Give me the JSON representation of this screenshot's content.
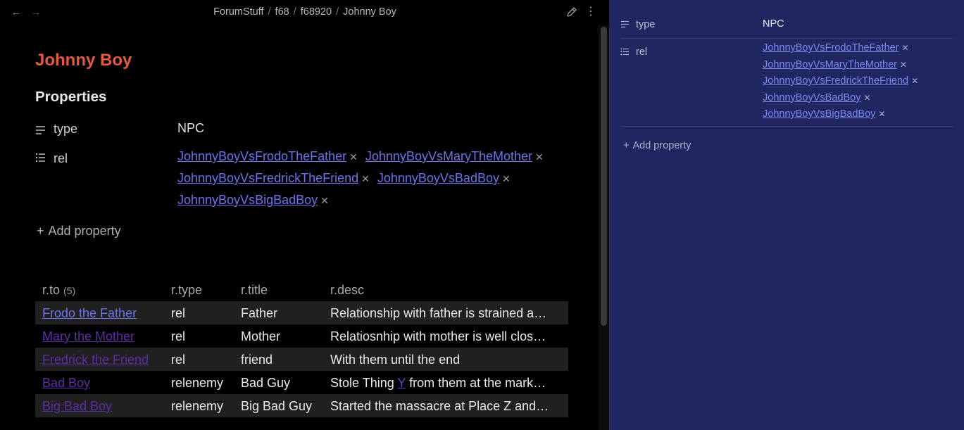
{
  "breadcrumb": [
    "ForumStuff",
    "f68",
    "f68920",
    "Johnny Boy"
  ],
  "breadcrumb_sep": "/",
  "icons": {
    "back": "arrow-left-icon",
    "forward": "arrow-right-icon",
    "edit": "pencil-icon",
    "more": "more-vertical-icon",
    "text_prop": "lines-icon",
    "list_prop": "list-icon",
    "remove": "close-icon",
    "add": "plus-icon"
  },
  "note": {
    "title": "Johnny Boy",
    "properties_heading": "Properties",
    "props": {
      "type_key": "type",
      "type_value": "NPC",
      "rel_key": "rel",
      "rel_links": [
        "JohnnyBoyVsFrodoTheFather",
        "JohnnyBoyVsMaryTheMother",
        "JohnnyBoyVsFredrickTheFriend",
        "JohnnyBoyVsBadBoy",
        "JohnnyBoyVsBigBadBoy"
      ]
    },
    "add_property": "Add property"
  },
  "table": {
    "headers": {
      "to": "r.to",
      "count": "(5)",
      "type": "r.type",
      "title": "r.title",
      "desc": "r.desc"
    },
    "rows": [
      {
        "to": "Frodo the Father",
        "type": "rel",
        "title": "Father",
        "desc": "Relationship with father is strained a…"
      },
      {
        "to": "Mary the Mother",
        "type": "rel",
        "title": "Mother",
        "desc": "Relatiosnhip with mother is well clos…"
      },
      {
        "to": "Fredrick the Friend",
        "type": "rel",
        "title": "friend",
        "desc": "With them until the end"
      },
      {
        "to": "Bad Boy",
        "type": "relenemy",
        "title": "Bad Guy",
        "desc_pre": "Stole Thing ",
        "desc_link": "Y",
        "desc_post": " from them at the mark…"
      },
      {
        "to": "Big Bad Boy",
        "type": "relenemy",
        "title": "Big Bad Guy",
        "desc": "Started the massacre at Place Z and…"
      }
    ]
  },
  "sidepanel": {
    "type_key": "type",
    "type_value": "NPC",
    "rel_key": "rel",
    "rel_links": [
      "JohnnyBoyVsFrodoTheFather",
      "JohnnyBoyVsMaryTheMother",
      "JohnnyBoyVsFredrickTheFriend",
      "JohnnyBoyVsBadBoy",
      "JohnnyBoyVsBigBadBoy"
    ],
    "add_property": "Add property"
  },
  "colors": {
    "title": "#e4583c",
    "link": "#6f71e8",
    "visited_link": "#5b2ea3",
    "side_bg": "#202660"
  }
}
